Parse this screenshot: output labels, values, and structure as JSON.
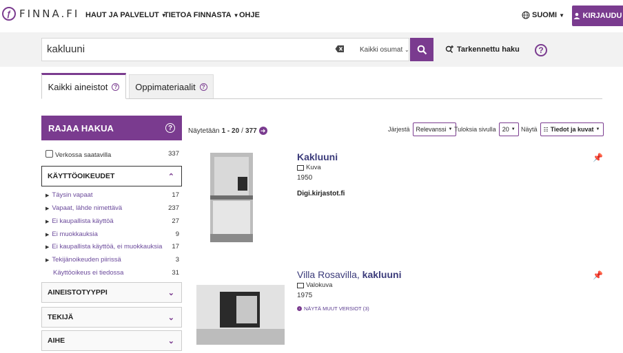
{
  "header": {
    "logo_text": "FINNA.FI",
    "nav": [
      {
        "label": "HAUT JA PALVELUT",
        "dropdown": true
      },
      {
        "label": "TIETOA FINNASTA",
        "dropdown": true
      },
      {
        "label": "OHJE",
        "dropdown": false
      }
    ],
    "language": "SUOMI",
    "login": "KIRJAUDU",
    "accent_color": "#7a3b8f"
  },
  "search": {
    "value": "kakluuni",
    "scope": "Kaikki osumat",
    "advanced": "Tarkennettu haku",
    "help": "?"
  },
  "tabs": [
    {
      "label": "Kaikki aineistot",
      "active": true
    },
    {
      "label": "Oppimateriaalit",
      "active": false
    }
  ],
  "sidebar": {
    "title": "RAJAA HAKUA",
    "online": {
      "label": "Verkossa saatavilla",
      "count": "337"
    },
    "rights": {
      "title": "KÄYTTÖOIKEUDET",
      "items": [
        {
          "label": "Täysin vapaat",
          "count": "17"
        },
        {
          "label": "Vapaat, lähde nimettävä",
          "count": "237"
        },
        {
          "label": "Ei kaupallista käyttöä",
          "count": "27"
        },
        {
          "label": "Ei muokkauksia",
          "count": "9"
        },
        {
          "label": "Ei kaupallista käyttöä, ei muokkauksia",
          "count": "17"
        },
        {
          "label": "Tekijänoikeuden piirissä",
          "count": "3"
        }
      ],
      "unknown": {
        "label": "Käyttöoikeus ei tiedossa",
        "count": "31"
      }
    },
    "sections": [
      "AINEISTOTYYPPI",
      "TEKIJÄ",
      "AIHE"
    ]
  },
  "results": {
    "showing_prefix": "Näytetään",
    "range": "1 - 20",
    "separator": "/",
    "total": "377",
    "sort_label": "Järjestä",
    "sort_value": "Relevanssi",
    "per_page_label": "Tuloksia sivulla",
    "per_page_value": "20",
    "view_label": "Näytä",
    "view_value": "Tiedot ja kuvat",
    "items": [
      {
        "title_prefix": "",
        "title_bold": "Kakluuni",
        "format": "Kuva",
        "year": "1950",
        "source": "Digi.kirjastot.fi"
      },
      {
        "title_prefix": "Villa Rosavilla, ",
        "title_bold": "kakluuni",
        "format": "Valokuva",
        "year": "1975",
        "versions": "NÄYTÄ MUUT VERSIOT (3)"
      }
    ]
  }
}
